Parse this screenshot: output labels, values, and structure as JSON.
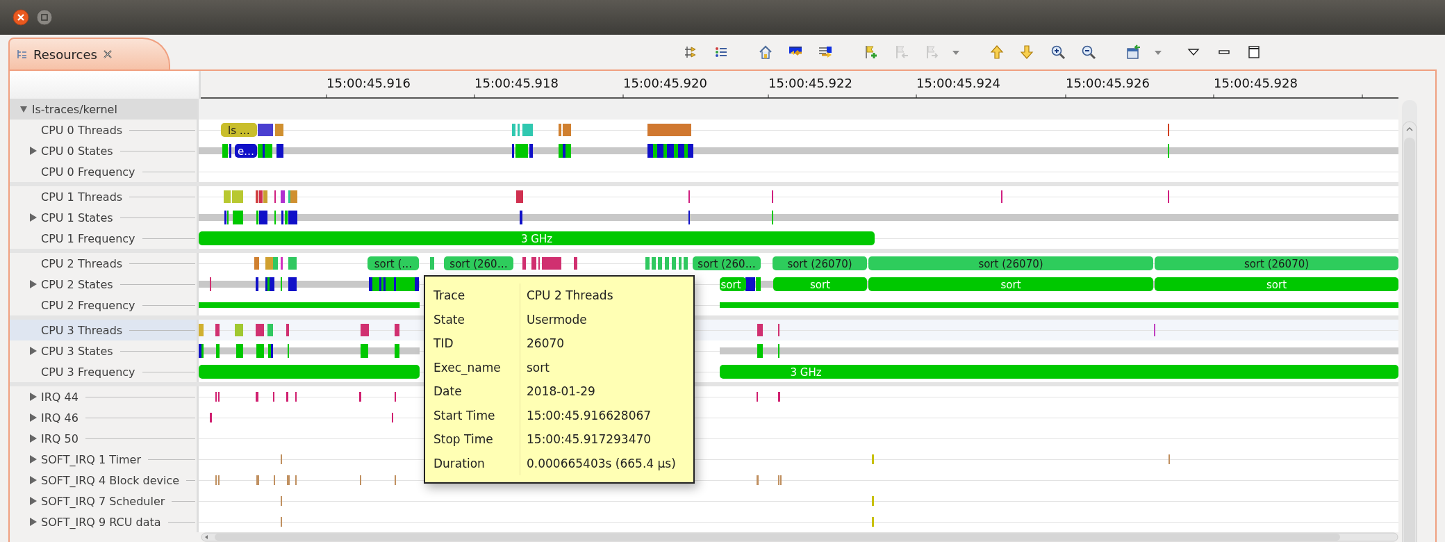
{
  "view_tab": {
    "label": "Resources",
    "selected": true
  },
  "toolbar": [
    {
      "disabled": false
    },
    {
      "disabled": false
    },
    {
      "disabled": false
    },
    {
      "disabled": false
    },
    {
      "disabled": false
    },
    {
      "disabled": false
    },
    {
      "disabled": true
    },
    {
      "disabled": true
    },
    {
      "disabled": false
    },
    {
      "disabled": false
    },
    {
      "disabled": false
    },
    {
      "disabled": false
    },
    {
      "disabled": false
    },
    {
      "disabled": false
    },
    {
      "disabled": false
    },
    {
      "disabled": false
    },
    {
      "disabled": false
    },
    {
      "disabled": false
    }
  ],
  "time_ruler": {
    "ticks": [
      "15:00:45.916",
      "15:00:45.918",
      "15:00:45.920",
      "15:00:45.922",
      "15:00:45.924",
      "15:00:45.926",
      "15:00:45.928"
    ]
  },
  "tree": {
    "label": "ls-traces/kernel",
    "expanded": true,
    "children": [
      {
        "label": "CPU 0 Threads",
        "kind": "threads",
        "selected": false,
        "segments": [
          {
            "label": "ls …",
            "color": "#c9be2c"
          }
        ]
      },
      {
        "label": "CPU 0 States",
        "kind": "states",
        "expanded": false,
        "selected": false,
        "segments": [
          {
            "label": "e…",
            "color": "#1010c8"
          }
        ]
      },
      {
        "label": "CPU 0 Frequency",
        "kind": "frequency",
        "selected": false
      },
      {
        "label": "CPU 1 Threads",
        "kind": "threads",
        "selected": false
      },
      {
        "label": "CPU 1 States",
        "kind": "states",
        "expanded": false,
        "selected": false
      },
      {
        "label": "CPU 1 Frequency",
        "kind": "frequency",
        "selected": false,
        "segments": [
          {
            "label": "3 GHz",
            "color": "#00c800"
          }
        ]
      },
      {
        "label": "CPU 2 Threads",
        "kind": "threads",
        "selected": false,
        "segments": [
          {
            "label": "sort (…",
            "color": "#2ecc5c"
          },
          {
            "label": "sort (260…",
            "color": "#2ecc5c"
          },
          {
            "label": "sort (260…",
            "color": "#2ecc5c"
          },
          {
            "label": "sort (26070)",
            "color": "#2ecc5c"
          },
          {
            "label": "sort (26070)",
            "color": "#2ecc5c"
          },
          {
            "label": "sort (26070)",
            "color": "#2ecc5c"
          }
        ]
      },
      {
        "label": "CPU 2 States",
        "kind": "states",
        "expanded": false,
        "selected": false,
        "segments": [
          {
            "label": "sort",
            "color": "#00c800"
          },
          {
            "label": "sort",
            "color": "#00c800"
          },
          {
            "label": "sort",
            "color": "#00c800"
          },
          {
            "label": "sort",
            "color": "#00c800"
          }
        ]
      },
      {
        "label": "CPU 2 Frequency",
        "kind": "frequency",
        "selected": false
      },
      {
        "label": "CPU 3 Threads",
        "kind": "threads",
        "selected": true
      },
      {
        "label": "CPU 3 States",
        "kind": "states",
        "expanded": false,
        "selected": false
      },
      {
        "label": "CPU 3 Frequency",
        "kind": "frequency",
        "selected": false,
        "segments": [
          {
            "label": "3 GHz",
            "color": "#00c800"
          }
        ]
      },
      {
        "label": "IRQ 44",
        "kind": "irq",
        "expanded": false,
        "selected": false
      },
      {
        "label": "IRQ 46",
        "kind": "irq",
        "expanded": false,
        "selected": false
      },
      {
        "label": "IRQ 50",
        "kind": "irq",
        "expanded": false,
        "selected": false
      },
      {
        "label": "SOFT_IRQ 1 Timer",
        "kind": "irq",
        "expanded": false,
        "selected": false
      },
      {
        "label": "SOFT_IRQ 4 Block device",
        "kind": "irq",
        "expanded": false,
        "selected": false
      },
      {
        "label": "SOFT_IRQ 7 Scheduler",
        "kind": "irq",
        "expanded": false,
        "selected": false
      },
      {
        "label": "SOFT_IRQ 9 RCU data",
        "kind": "irq",
        "expanded": false,
        "selected": false
      }
    ]
  },
  "tooltip": {
    "rows": [
      {
        "key": "Trace",
        "value": "CPU 2 Threads"
      },
      {
        "key": "State",
        "value": "Usermode"
      },
      {
        "key": "TID",
        "value": "26070"
      },
      {
        "key": "Exec_name",
        "value": "sort"
      },
      {
        "key": "Date",
        "value": "2018-01-29"
      },
      {
        "key": "Start Time",
        "value": "15:00:45.916628067"
      },
      {
        "key": "Stop Time",
        "value": "15:00:45.917293470"
      },
      {
        "key": "Duration",
        "value": "0.000665403s (665.4 μs)"
      }
    ]
  }
}
